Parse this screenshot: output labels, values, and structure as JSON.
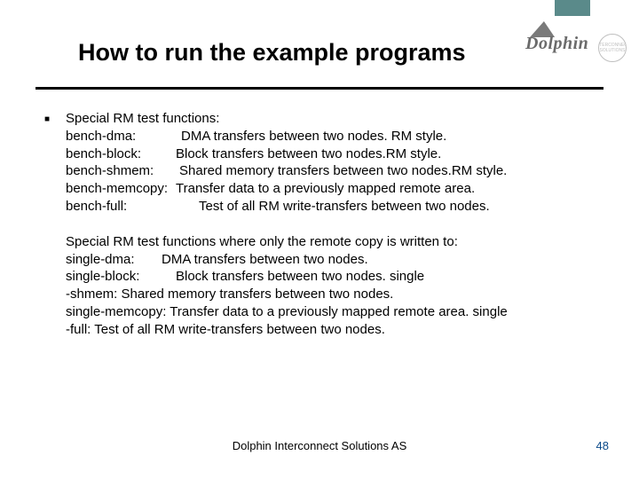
{
  "logo": {
    "brand": "Dolphin",
    "badge": "INTERCONNECT SOLUTIONS"
  },
  "title": "How to run the example programs",
  "section1": {
    "heading": "Special RM test functions:",
    "items": {
      "dma": {
        "name": "bench-dma:",
        "desc": "DMA transfers between two nodes. RM style."
      },
      "block": {
        "name": "bench-block:",
        "desc": "Block transfers between two nodes.RM style."
      },
      "shmem": {
        "name": "bench-shmem:",
        "desc": "Shared memory transfers between two nodes.RM style."
      },
      "memcopy": {
        "name": "bench-memcopy:",
        "desc": "Transfer data to a previously mapped remote area."
      },
      "full": {
        "name": "bench-full:",
        "desc": "Test of all RM write-transfers between two nodes."
      }
    }
  },
  "section2": {
    "heading": "Special RM test functions where only the remote copy is written to:",
    "l1a": "single-dma:",
    "l1b": "DMA transfers between two nodes.",
    "l2a": "single-block:",
    "l2b": "Block transfers between two nodes.                                             single",
    "l3": "-shmem:   Shared memory transfers between two nodes.",
    "l4": "single-memcopy: Transfer data to a previously mapped remote area.           single",
    "l5": "-full:              Test of all RM write-transfers between two nodes."
  },
  "footer": {
    "org": "Dolphin Interconnect Solutions AS",
    "page": "48"
  }
}
